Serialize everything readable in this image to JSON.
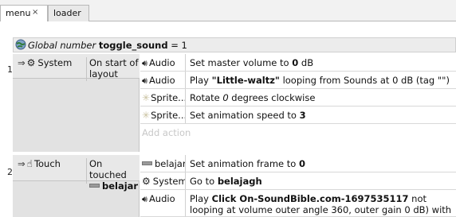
{
  "tabs": [
    {
      "label": "menu",
      "close": "×"
    },
    {
      "label": "loader"
    }
  ],
  "global": {
    "prefix": "Global number",
    "name": "toggle_sound",
    "suffix": "= 1"
  },
  "events": [
    {
      "number": "1",
      "arrow": "⇒",
      "object": "System",
      "condition": "On start of layout",
      "actions": [
        {
          "object": "Audio",
          "parts": [
            [
              "t",
              "Set master volume to "
            ],
            [
              "b",
              "0"
            ],
            [
              "t",
              " dB"
            ]
          ]
        },
        {
          "object": "Audio",
          "parts": [
            [
              "t",
              "Play "
            ],
            [
              "b",
              "\"Little-waltz\""
            ],
            [
              "t",
              " looping from Sounds at 0 dB (tag \"\")"
            ]
          ]
        },
        {
          "object": "Sprite...",
          "parts": [
            [
              "t",
              "Rotate "
            ],
            [
              "i",
              "0"
            ],
            [
              "t",
              " degrees clockwise"
            ]
          ]
        },
        {
          "object": "Sprite...",
          "parts": [
            [
              "t",
              "Set animation speed to "
            ],
            [
              "b",
              "3"
            ]
          ]
        }
      ],
      "add_action": "Add action"
    },
    {
      "number": "2",
      "arrow": "⇒",
      "object": "Touch",
      "condition": "On touched",
      "condition_target": "belajar",
      "actions": [
        {
          "object": "belajar",
          "parts": [
            [
              "t",
              "Set animation frame to "
            ],
            [
              "b",
              "0"
            ]
          ]
        },
        {
          "object": "System",
          "parts": [
            [
              "t",
              "Go to "
            ],
            [
              "b",
              "belajagh"
            ]
          ]
        },
        {
          "object": "Audio",
          "parts": [
            [
              "t",
              "Play "
            ],
            [
              "b",
              "Click On-SoundBible.com-1697535117"
            ],
            [
              "t",
              " not looping at volume "
            ],
            [
              "t",
              " outer angle 360, outer gain 0 dB) with tag \"\""
            ]
          ]
        }
      ]
    }
  ]
}
